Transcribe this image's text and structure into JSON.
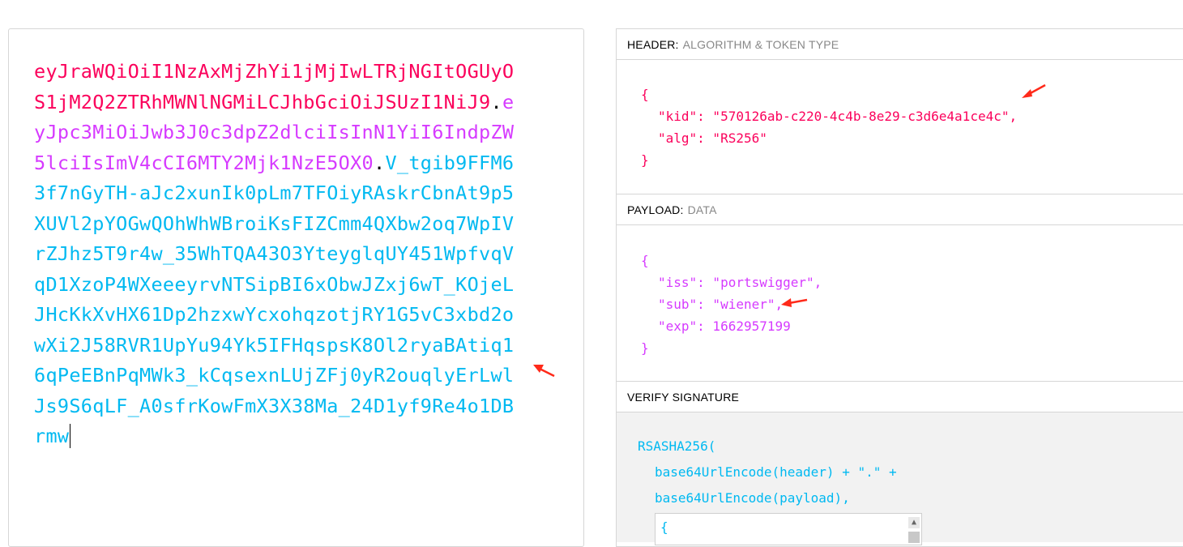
{
  "encoded": {
    "header_part": "eyJraWQiOiI1NzAxMjZhYi1jMjIwLTRjNGItOGUyOS1jM2Q2ZTRhMWNlNGMiLCJhbGciOiJSUzI1NiJ9",
    "payload_part": "eyJpc3MiOiJwb3J0c3dpZ2dlciIsInN1YiI6IndpZW5lciIsImV4cCI6MTY2Mjk1NzE5OX0",
    "signature_part": "V_tgib9FFM63f7nGyTH-aJc2xunIk0pLm7TFOiyRAskrCbnAt9p5XUVl2pYOGwQOhWhWBroiKsFIZCmm4QXbw2oq7WpIVrZJhz5T9r4w_35WhTQA43O3YteyglqUY451WpfvqVqD1XzoP4WXeeeyrvNTSipBI6xObwJZxj6wT_KOjeLJHcKkXvHX61Dp2hzxwYcxohqzotjRY1G5vC3xbd2owXi2J58RVR1UpYu94Yk5IFHqspsK8Ol2ryaBAtiq16qPeEBnPqMWk3_kCqsexnLUjZFj0yR2ouqlyErLwlJs9S6qLF_A0sfrKowFmX3X38Ma_24D1yf9Re4o1DBrmw",
    "dot": "."
  },
  "decoded": {
    "header": {
      "title": "HEADER:",
      "subtitle": "ALGORITHM & TOKEN TYPE",
      "open_brace": "{",
      "kid_line": "\"kid\": \"570126ab-c220-4c4b-8e29-c3d6e4a1ce4c\",",
      "alg_line": "\"alg\": \"RS256\"",
      "close_brace": "}"
    },
    "payload": {
      "title": "PAYLOAD:",
      "subtitle": "DATA",
      "open_brace": "{",
      "iss_line": "\"iss\": \"portswigger\",",
      "sub_line": "\"sub\": \"wiener\",",
      "exp_line": "\"exp\": 1662957199",
      "close_brace": "}"
    },
    "verify": {
      "title": "VERIFY SIGNATURE",
      "fn_line": "RSASHA256(",
      "header_line": "base64UrlEncode(header) + \".\" +",
      "payload_line": "base64UrlEncode(payload),",
      "key_open": "{"
    }
  },
  "colors": {
    "header": "#fb015b",
    "payload": "#d63aff",
    "signature": "#00b9f1",
    "annotation_arrow": "#ff2a1a"
  },
  "icons": [
    "red-annotation-arrow",
    "scroll-up-arrow-icon"
  ]
}
